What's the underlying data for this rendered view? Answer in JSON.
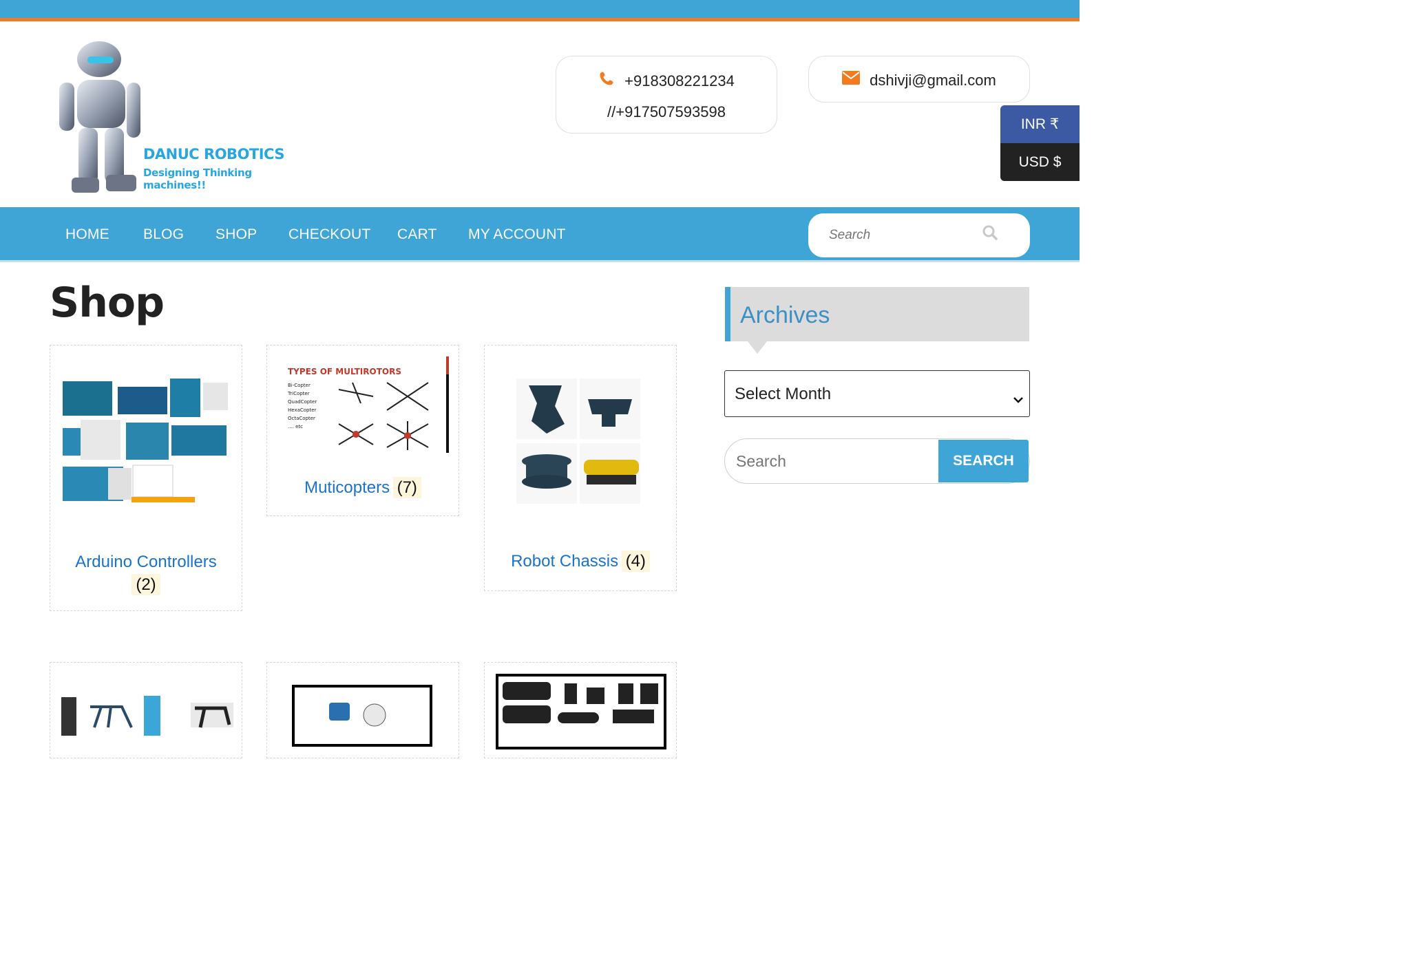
{
  "brand": {
    "name": "DANUC ROBOTICS",
    "tagline": "Designing Thinking machines!!"
  },
  "contact": {
    "phone_primary": "+918308221234",
    "phone_secondary": "//+917507593598",
    "email": "dshivji@gmail.com"
  },
  "currency": {
    "inr": "INR ₹",
    "usd": "USD $"
  },
  "nav": {
    "items": [
      "HOME",
      "BLOG",
      "SHOP",
      "CHECKOUT",
      "CART",
      "MY ACCOUNT"
    ],
    "search_placeholder": "Search"
  },
  "page": {
    "title": "Shop"
  },
  "categories": [
    {
      "name": "Arduino Controllers",
      "count": "(2)"
    },
    {
      "name": "Muticopters",
      "count": "(7)"
    },
    {
      "name": "Robot Chassis",
      "count": "(4)"
    }
  ],
  "multirotor_image_text": {
    "heading": "TYPES OF MULTIROTORS",
    "list": [
      "Bi-Copter",
      "TriCopter",
      "QuadCopter",
      "HexaCopter",
      "OctaCopter",
      ".... etc"
    ]
  },
  "sidebar": {
    "archives_title": "Archives",
    "select_month": "Select Month",
    "search_placeholder": "Search",
    "search_button": "SEARCH"
  },
  "colors": {
    "topbar": "#3ea5d6",
    "accent_orange": "#f47a20",
    "link_blue": "#1a73c9",
    "inr_bg": "#3b5aa3",
    "usd_bg": "#222222"
  }
}
